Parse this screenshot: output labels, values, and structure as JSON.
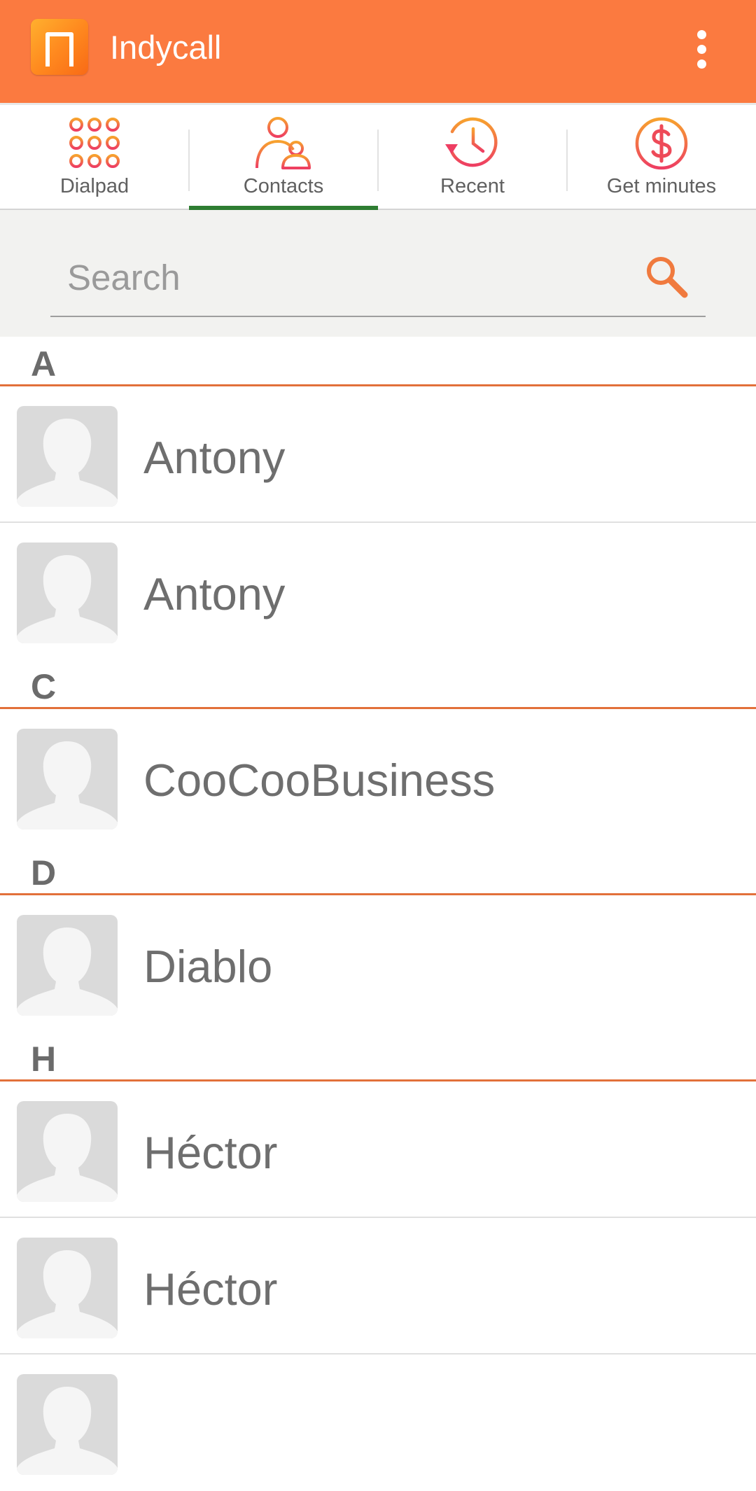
{
  "app": {
    "title": "Indycall"
  },
  "tabs": [
    {
      "label": "Dialpad",
      "icon": "dialpad-icon",
      "selected": false
    },
    {
      "label": "Contacts",
      "icon": "contacts-icon",
      "selected": true
    },
    {
      "label": "Recent",
      "icon": "recent-history-icon",
      "selected": false
    },
    {
      "label": "Get minutes",
      "icon": "dollar-coin-icon",
      "selected": false
    }
  ],
  "search": {
    "placeholder": "Search",
    "value": ""
  },
  "sections": [
    {
      "letter": "A",
      "contacts": [
        "Antony",
        "Antony"
      ]
    },
    {
      "letter": "C",
      "contacts": [
        "CooCooBusiness"
      ]
    },
    {
      "letter": "D",
      "contacts": [
        "Diablo"
      ]
    },
    {
      "letter": "H",
      "contacts": [
        "Héctor",
        "Héctor"
      ]
    }
  ],
  "colors": {
    "appbar": "#FB7A40",
    "accent": "#E2703A",
    "tab_indicator": "#2E7D32",
    "icon_gradient_start": "#F7A22E",
    "icon_gradient_end": "#EE3E62"
  }
}
